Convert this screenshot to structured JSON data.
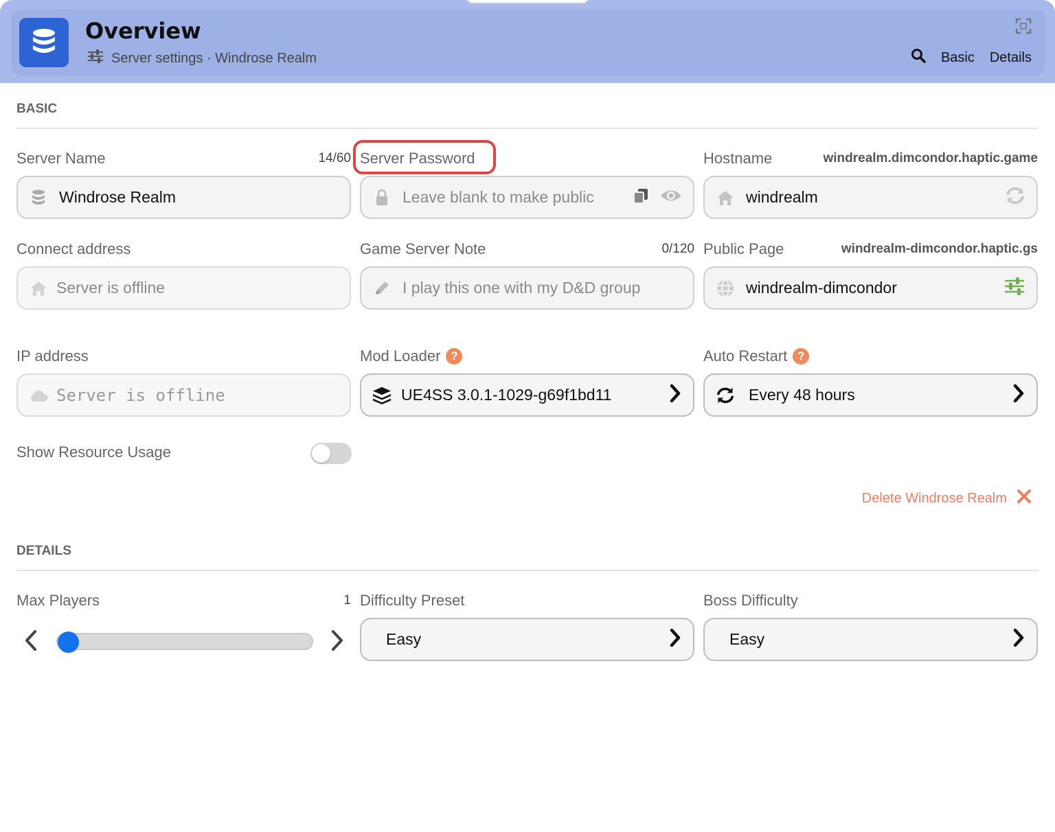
{
  "header": {
    "title": "Overview",
    "breadcrumb": "Server settings · Windrose Realm",
    "nav": [
      "Basic",
      "Details"
    ]
  },
  "sections": {
    "basic": "BASIC",
    "details": "DETAILS"
  },
  "fields": {
    "server_name": {
      "label": "Server Name",
      "counter": "14/60",
      "value": "Windrose Realm"
    },
    "server_password": {
      "label": "Server Password",
      "placeholder": "Leave blank to make public"
    },
    "hostname": {
      "label": "Hostname",
      "meta": "windrealm.dimcondor.haptic.game",
      "value": "windrealm"
    },
    "connect_address": {
      "label": "Connect address",
      "placeholder": "Server is offline"
    },
    "game_server_note": {
      "label": "Game Server Note",
      "counter": "0/120",
      "placeholder": "I play this one with my D&D group"
    },
    "public_page": {
      "label": "Public Page",
      "meta": "windrealm-dimcondor.haptic.gs",
      "value": "windrealm-dimcondor"
    },
    "ip_address": {
      "label": "IP address",
      "placeholder": "Server is offline"
    },
    "mod_loader": {
      "label": "Mod Loader",
      "value": "UE4SS 3.0.1-1029-g69f1bd11"
    },
    "auto_restart": {
      "label": "Auto Restart",
      "value": "Every 48 hours"
    },
    "show_resource_usage": {
      "label": "Show Resource Usage",
      "enabled": false
    },
    "max_players": {
      "label": "Max Players",
      "value": "1"
    },
    "difficulty_preset": {
      "label": "Difficulty Preset",
      "value": "Easy"
    },
    "boss_difficulty": {
      "label": "Boss Difficulty",
      "value": "Easy"
    }
  },
  "delete_link": "Delete Windrose Realm",
  "colors": {
    "header_band": "#a8b9ee",
    "header_card": "#9eb1e6",
    "app_icon": "#2e63d6",
    "danger": "#ee7d5e",
    "help": "#ee8a5b",
    "slider_thumb": "#1471f0",
    "highlight": "#e04545"
  }
}
